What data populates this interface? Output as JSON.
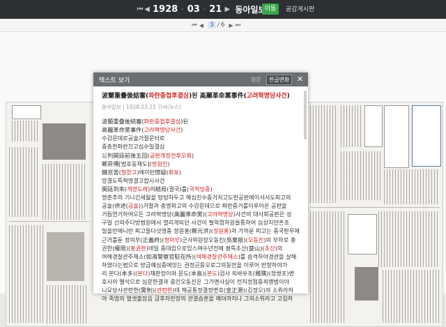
{
  "topbar": {
    "year": "1928",
    "month": "03",
    "day": "21",
    "date_year_unit": "",
    "newspaper": "동아일보",
    "move_button": "이동",
    "notice_link": "공감게시판"
  },
  "pager": {
    "current": "3",
    "total": "6"
  },
  "modal": {
    "title": "텍스트 보기",
    "tab_original": "원문",
    "tab_modern": "한글변환",
    "headline_prefix": "波蘭重疊後結審(",
    "headline_red1": "파란중첩후결심",
    "headline_mid": ")된 高麗革命黨事件(",
    "headline_red2": "고려혁명당사건",
    "headline_suffix": ")",
    "meta": "동아일보 | 1928.03.21 기사(뉴스)",
    "lines": [
      {
        "pre": "波蘭重疊後結審(",
        "red": "파란중첩후결심",
        "post": ")된"
      },
      {
        "pre": "高麗革命黨事件(",
        "red": "고려혁명당사건",
        "post": ")"
      },
      {
        "pre": "수감문데로공술거절문터로",
        "red": "",
        "post": ""
      },
      {
        "pre": "중층한파란끄고심수일결심",
        "red": "",
        "post": ""
      },
      {
        "pre": "公判開廷前後五回(",
        "red": "공판개정전후오회",
        "post": ")"
      },
      {
        "pre": "鄭昇傳[법호동재도](",
        "red": "방원인",
        "post": ")"
      },
      {
        "pre": "鐵窓苦(",
        "red": "철창고",
        "post": ")에이린懷疑(",
        "red2": "회포",
        "post2": ")"
      },
      {
        "pre": "망결도특혁명결고합시사건",
        "red": "",
        "post": ""
      },
      {
        "pre": "開廷到來(",
        "red": "개정도래",
        "post": ")의結局(결국)를(",
        "red2": "국적밍중",
        "post2": ")"
      },
      {
        "pre": "멍춘추의 기나긴세월을 텅텅하두고 예심진수중거처고도한공판에이서서도피고의",
        "red": "",
        "post": ""
      },
      {
        "pre": "공술(供述(",
        "red": "공술",
        "post": "))거절과 충명피고의 수감문데으로 파란중거를이루어온 공판을",
        "red2": "",
        "post2": ""
      },
      {
        "pre": "거듭연거하여오든 고려혁명당(高麗革命黨)(",
        "red": "고려혁명당",
        "post": ")사건의 대사회공판은 성",
        "red2": "",
        "post2": ""
      },
      {
        "pre": "구일 산의주다방법원에서 열리게되던 사건이 필악접하원들통하여 심상치안흔조",
        "red": "",
        "post": ""
      },
      {
        "pre": "일을만에니린 피고들다섯명중 정원홍(鄭元洪)(",
        "red": "정원홍",
        "post": ")과 가까운 피고는 중국판무에",
        "red2": "",
        "post2": ""
      },
      {
        "pre": "근거를둔 정의부(正義府)(",
        "red": "정의부",
        "post": ")군사위원장오동진(吳東振)(",
        "red2": "오동진",
        "post2": ")의 부하로 총"
      },
      {
        "pre": "권한(權限)(",
        "red": "홍권한",
        "post": ")데일 중대임으로있스며수년전에 평특초산(楚山)(",
        "red2": "초산",
        "post2": ")의"
      },
      {
        "pre": "여해경찰관주재소(如海警察官駐在所)(",
        "red": "여해경찰관주재소",
        "post": ")를 습격하야경관을 살해",
        "red2": "",
        "post2": ""
      },
      {
        "pre": "하였다는범으로 방금예심중에잇는 권정곤등오로그의동안을 이루어 반항하야가",
        "red": "",
        "post": ""
      },
      {
        "pre": "리 본다(本多)(",
        "red": "본다",
        "post": ")재판장이와 문도(本島)(",
        "red2": "본도",
        "post2": ")검사 외바우조(雅隅)(정쌍조)변"
      },
      {
        "pre": "호사의 펠석으로 심문한결과 중인오동진은 그가맨사실이 전지정점중죄행범이아",
        "red": "",
        "post": ""
      },
      {
        "pre": "니요당사관련한(實劍)(",
        "red": "관련한",
        "post": ")데 해공통정결정변호(金正源)(김정오)의 소위라하",
        "red2": "",
        "post2": ""
      },
      {
        "pre": "야 죽엄의 열셋출잡음 금후자찬장의 관결습훈을 예뎌까지나 그의소위라고 고집하",
        "red": "",
        "post": ""
      }
    ]
  },
  "colors": {
    "topbar_bg": "#2c2f33",
    "move_button_bg": "#3aa64a",
    "modal_header_bg": "#6b6e73",
    "red_text": "#cc2020",
    "pager_current": "#2855b5"
  },
  "icons": [
    "first-page-icon",
    "prev-page-icon",
    "next-page-icon",
    "last-page-icon",
    "close-icon",
    "prev-date-icon",
    "next-date-icon"
  ]
}
